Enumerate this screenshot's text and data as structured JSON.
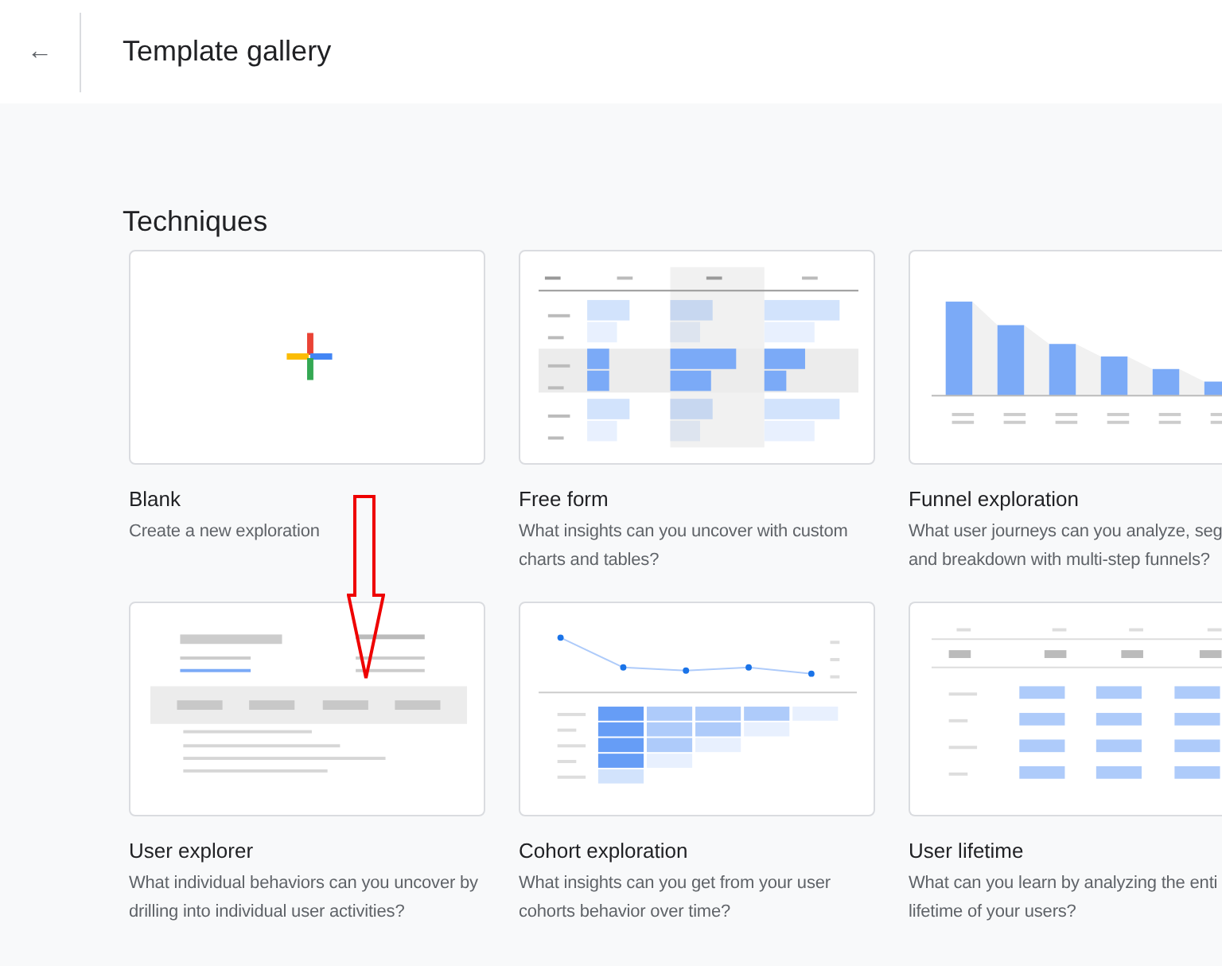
{
  "header": {
    "back_icon": "←",
    "title": "Template gallery"
  },
  "section": {
    "title": "Techniques"
  },
  "cards": [
    {
      "kind": "blank",
      "title": "Blank",
      "description_lines": [
        "Create a new exploration"
      ]
    },
    {
      "kind": "freeform",
      "title": "Free form",
      "description_lines": [
        "What insights can you uncover with custom",
        "charts and tables?"
      ]
    },
    {
      "kind": "funnel",
      "title": "Funnel exploration",
      "description_lines": [
        "What user journeys can you analyze, seg",
        "and breakdown with multi-step funnels?"
      ]
    },
    {
      "kind": "explorer",
      "title": "User explorer",
      "description_lines": [
        "What individual behaviors can you uncover by",
        "drilling into individual user activities?"
      ]
    },
    {
      "kind": "cohort",
      "title": "Cohort exploration",
      "description_lines": [
        "What insights can you get from your user",
        "cohorts behavior over time?"
      ]
    },
    {
      "kind": "lifetime",
      "title": "User lifetime",
      "description_lines": [
        "What can you learn by analyzing the enti",
        "lifetime of your users?"
      ]
    }
  ]
}
